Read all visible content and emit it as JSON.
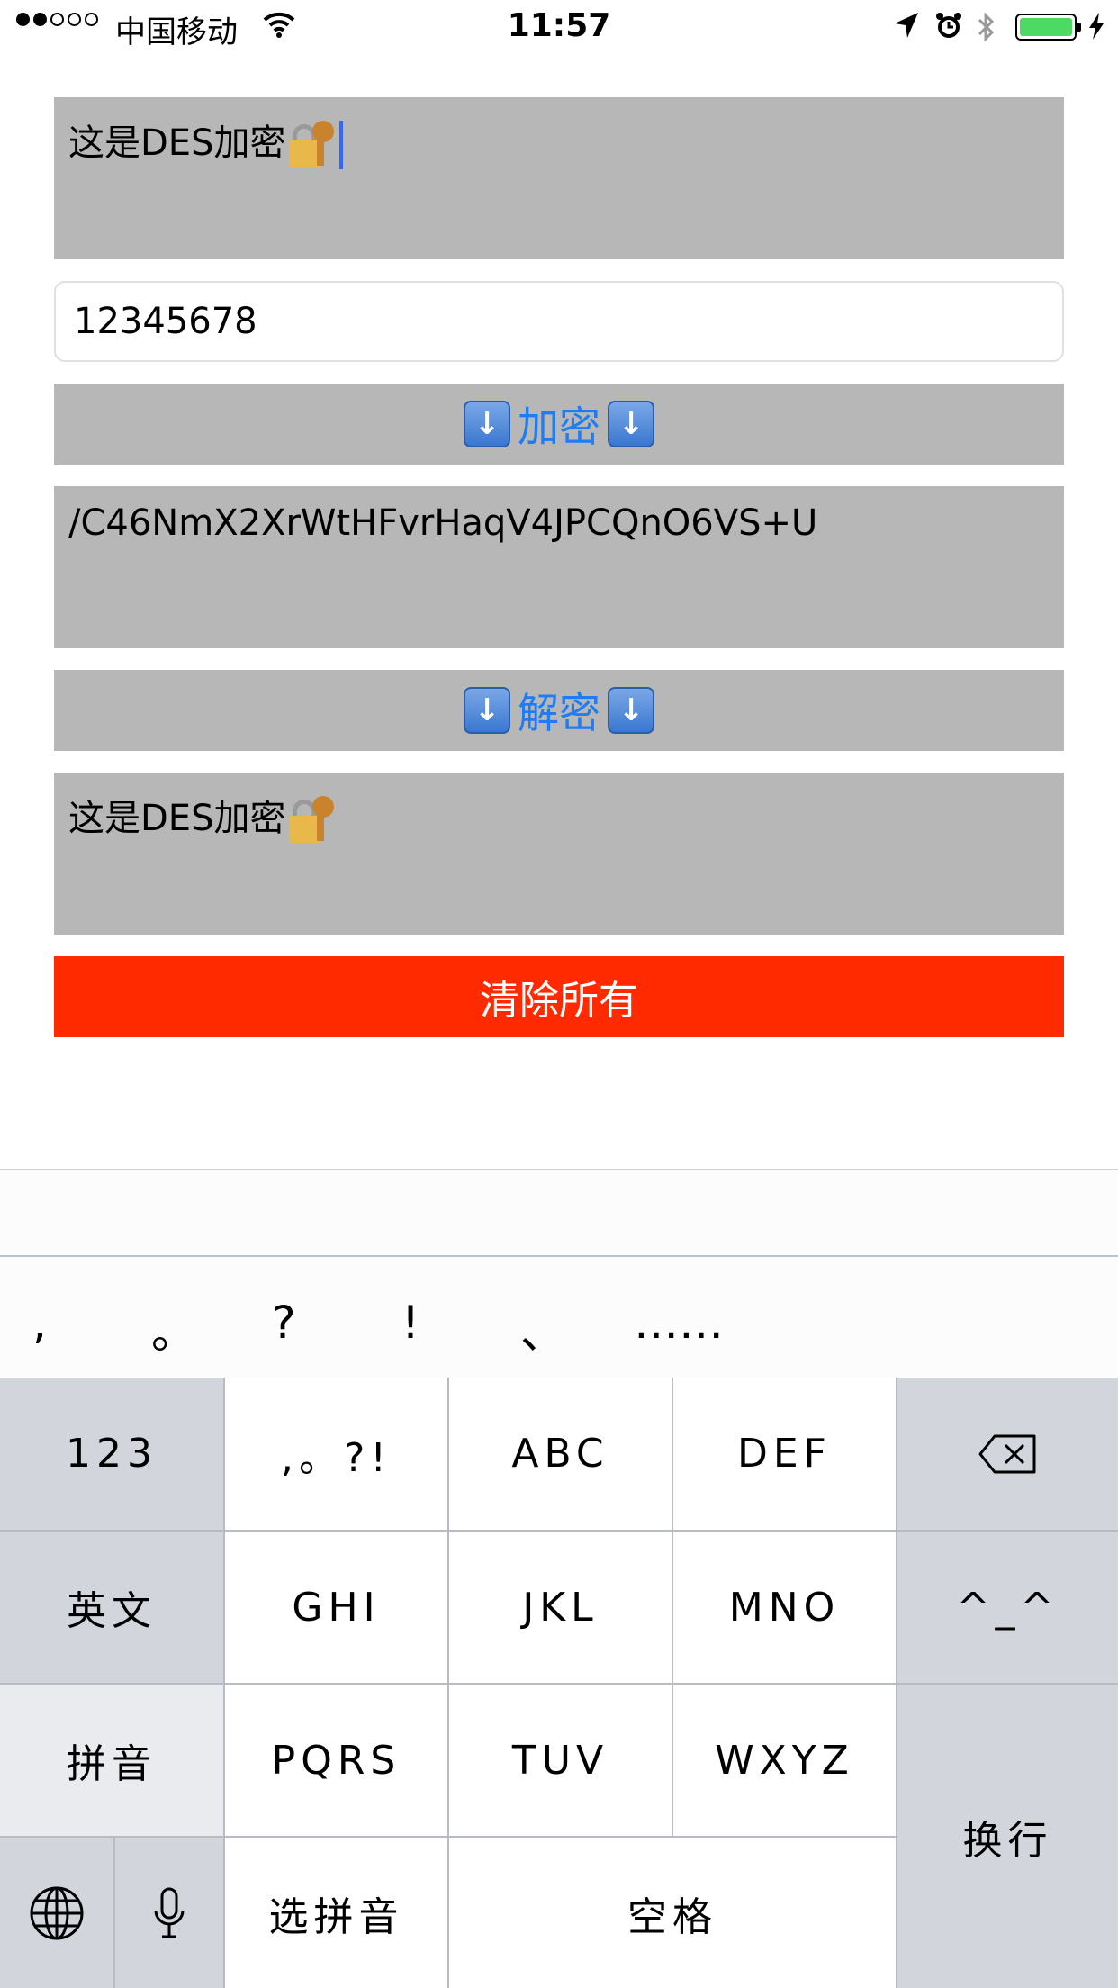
{
  "status_bar": {
    "carrier": "中国移动",
    "time": "11:57"
  },
  "input_text": "这是DES加密",
  "key_value": "12345678",
  "encrypt_label": "加密",
  "encrypted_output": "/C46NmX2XrWtHFvrHaqV4JPCQnO6VS+U",
  "decrypt_label": "解密",
  "decrypted_output": "这是DES加密",
  "clear_label": "清除所有",
  "colors": {
    "box_gray": "#b7b7b7",
    "action_blue": "#1f7cf2",
    "clear_red": "#ff2a00",
    "battery_green": "#4cd964"
  },
  "keyboard": {
    "punctuation": [
      ",",
      "。",
      "?",
      "!",
      "、",
      "……"
    ],
    "keys": {
      "num": "123",
      "punc": ",。?!",
      "abc": "ABC",
      "def": "DEF",
      "english": "英文",
      "ghi": "GHI",
      "jkl": "JKL",
      "mno": "MNO",
      "emoticon": "^_^",
      "pinyin": "拼音",
      "pqrs": "PQRS",
      "tuv": "TUV",
      "wxyz": "WXYZ",
      "return": "换行",
      "select_pinyin": "选拼音",
      "space": "空格"
    }
  }
}
